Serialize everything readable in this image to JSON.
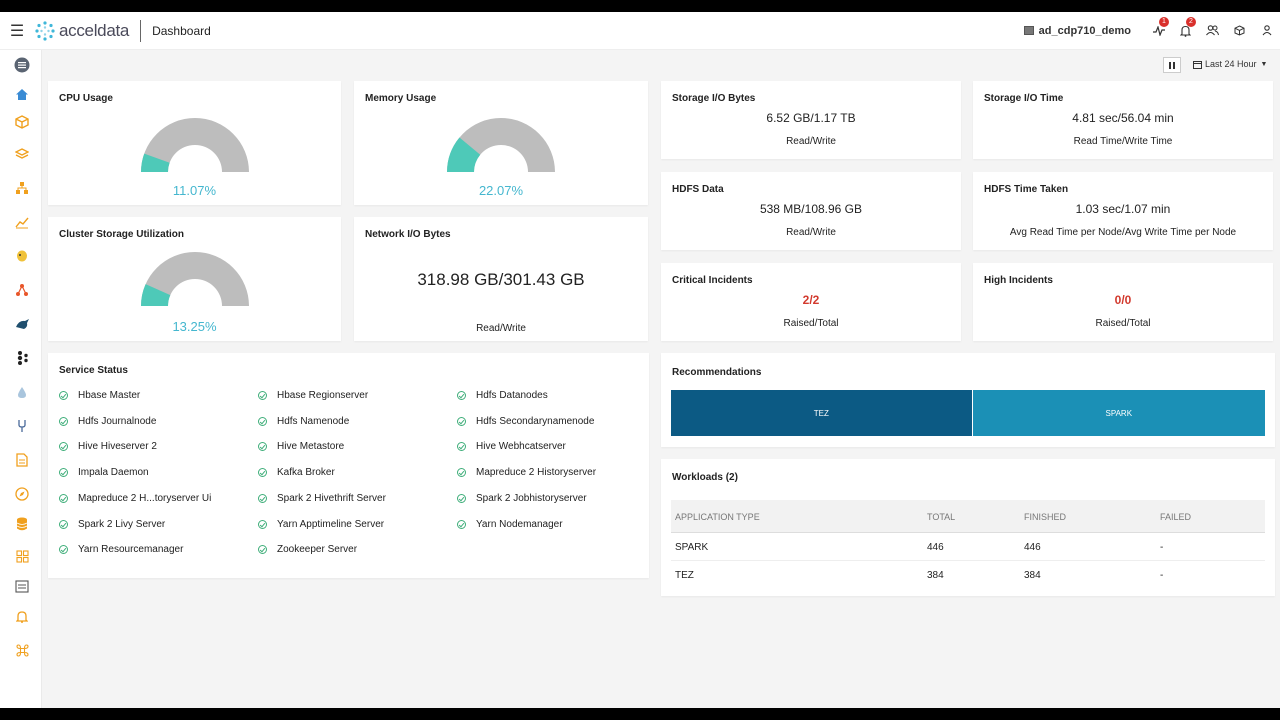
{
  "header": {
    "logo_text": "acceldata",
    "page_title": "Dashboard",
    "cluster_name": "ad_cdp710_demo",
    "alerts_badge": "1",
    "notifications_badge": "2"
  },
  "toolbar": {
    "time_range": "Last 24 Hour"
  },
  "cpu": {
    "title": "CPU Usage",
    "value": "11.07%",
    "fraction": 0.1107
  },
  "memory": {
    "title": "Memory Usage",
    "value": "22.07%",
    "fraction": 0.2207
  },
  "storage_io_bytes": {
    "title": "Storage I/O Bytes",
    "value": "6.52 GB/1.17 TB",
    "label": "Read/Write"
  },
  "storage_io_time": {
    "title": "Storage I/O Time",
    "value": "4.81 sec/56.04 min",
    "label": "Read Time/Write Time"
  },
  "hdfs_data": {
    "title": "HDFS Data",
    "value": "538 MB/108.96 GB",
    "label": "Read/Write"
  },
  "hdfs_time": {
    "title": "HDFS Time Taken",
    "value": "1.03 sec/1.07 min",
    "label": "Avg Read Time per Node/Avg Write Time per Node"
  },
  "cluster_storage": {
    "title": "Cluster Storage Utilization",
    "value": "13.25%",
    "fraction": 0.1325
  },
  "network_io": {
    "title": "Network I/O Bytes",
    "value": "318.98 GB/301.43 GB",
    "label": "Read/Write"
  },
  "critical_incidents": {
    "title": "Critical Incidents",
    "value": "2/2",
    "label": "Raised/Total"
  },
  "high_incidents": {
    "title": "High Incidents",
    "value": "0/0",
    "label": "Raised/Total"
  },
  "service_status": {
    "title": "Service Status",
    "services": [
      "Hbase Master",
      "Hbase Regionserver",
      "Hdfs Datanodes",
      "Hdfs Journalnode",
      "Hdfs Namenode",
      "Hdfs Secondarynamenode",
      "Hive Hiveserver 2",
      "Hive Metastore",
      "Hive Webhcatserver",
      "Impala Daemon",
      "Kafka Broker",
      "Mapreduce 2 Historyserver",
      "Mapreduce 2 H...toryserver Ui",
      "Spark 2 Hivethrift Server",
      "Spark 2 Jobhistoryserver",
      "Spark 2 Livy Server",
      "Yarn Apptimeline Server",
      "Yarn Nodemanager",
      "Yarn Resourcemanager",
      "Zookeeper Server"
    ]
  },
  "recommendations": {
    "title": "Recommendations",
    "segments": [
      {
        "label": "TEZ",
        "share": 0.506,
        "color": "#0c5a84"
      },
      {
        "label": "SPARK",
        "share": 0.494,
        "color": "#1b90b6"
      }
    ]
  },
  "workloads": {
    "title": "Workloads (2)",
    "columns": [
      "APPLICATION TYPE",
      "TOTAL",
      "FINISHED",
      "FAILED"
    ],
    "rows": [
      [
        "SPARK",
        "446",
        "446",
        "-"
      ],
      [
        "TEZ",
        "384",
        "384",
        "-"
      ]
    ]
  },
  "colors": {
    "gauge_fill": "#4ec9b8",
    "gauge_track": "#bdbdbd",
    "accent": "#45b7cf",
    "critical": "#d23a2e"
  },
  "sidebar_icons": [
    "list-icon",
    "home-icon",
    "cube-icon",
    "layers-icon",
    "hierarchy-icon",
    "chart-icon",
    "hadoop-elephant-icon",
    "pipeline-icon",
    "hive-icon",
    "kafka-icon",
    "drop-icon",
    "tuning-fork-icon",
    "document-icon",
    "compass-icon",
    "database-icon",
    "grid-icon",
    "report-icon",
    "bell-icon",
    "command-icon"
  ]
}
